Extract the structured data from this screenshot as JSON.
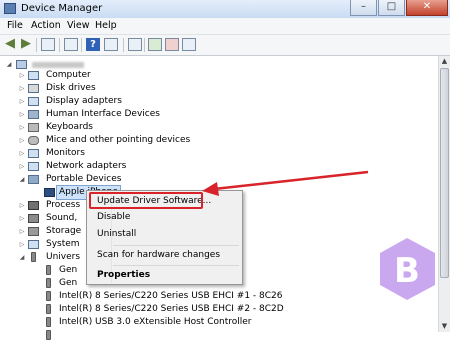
{
  "window": {
    "title": "Device Manager",
    "controls": {
      "minimize": "–",
      "maximize": "□",
      "close": "✕"
    }
  },
  "menu": {
    "file": "File",
    "action": "Action",
    "view": "View",
    "help": "Help"
  },
  "toolbar": {
    "help_glyph": "?"
  },
  "tree": {
    "computer": "Computer",
    "disk_drives": "Disk drives",
    "display_adapters": "Display adapters",
    "hid": "Human Interface Devices",
    "keyboards": "Keyboards",
    "mice": "Mice and other pointing devices",
    "monitors": "Monitors",
    "network_adapters": "Network adapters",
    "portable_devices": "Portable Devices",
    "apple_iphone": "Apple iPhone",
    "processors": "Process",
    "sound": "Sound,",
    "storage": "Storage",
    "system": "System",
    "universal": "Univers",
    "usb_gen1": "Gen",
    "usb_gen2": "Gen",
    "usb_ehci1": "Intel(R) 8 Series/C220 Series USB EHCI #1 - 8C26",
    "usb_ehci2": "Intel(R) 8 Series/C220 Series USB EHCI #2 - 8C2D",
    "usb_xhci": "Intel(R) USB 3.0 eXtensible Host Controller"
  },
  "context_menu": {
    "update": "Update Driver Software...",
    "disable": "Disable",
    "uninstall": "Uninstall",
    "scan": "Scan for hardware changes",
    "properties": "Properties"
  },
  "colors": {
    "highlight": "#d8232a",
    "logo": "#c9a8f0"
  }
}
